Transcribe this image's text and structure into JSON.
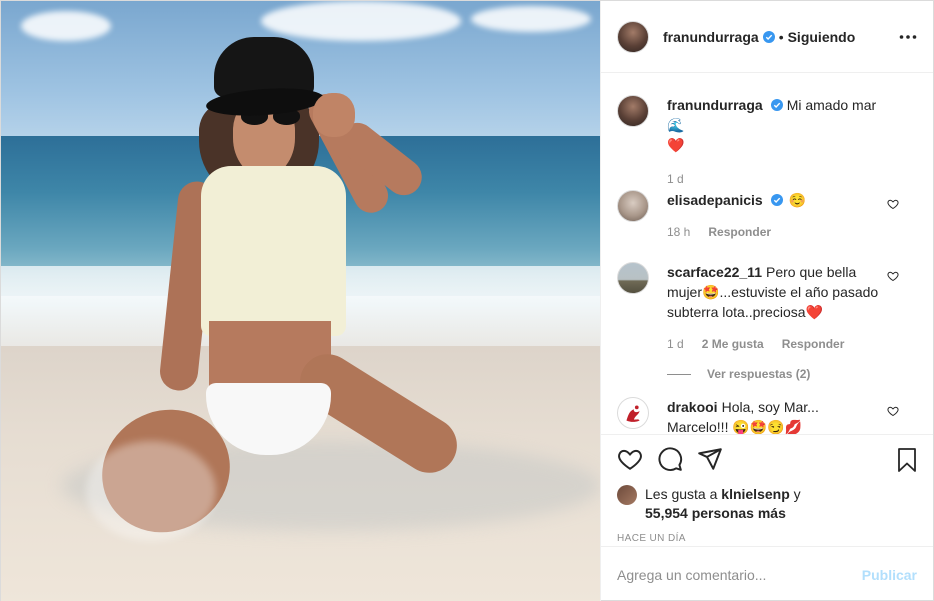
{
  "post": {
    "author": "franundurraga",
    "follow_status": "Siguiendo",
    "separator": "•",
    "caption_text": "Mi amado mar 🌊",
    "caption_emoji_line": "❤️",
    "caption_age": "1 d",
    "time_ago": "HACE UN DÍA",
    "brand_blue": "#0095f6",
    "publish_disabled_color": "#b2dffc"
  },
  "comments": [
    {
      "user": "elisadepanicis",
      "verified": true,
      "text": "☺️",
      "age": "18 h",
      "reply_label": "Responder"
    },
    {
      "user": "scarface22_11",
      "verified": false,
      "text": "Pero que bella mujer🤩...estuviste el año pasado subterra lota..preciosa❤️",
      "age": "1 d",
      "likes_label": "2 Me gusta",
      "reply_label": "Responder",
      "view_replies": "Ver respuestas (2)"
    },
    {
      "user": "drakooi",
      "verified": false,
      "text": "Hola, soy Mar... Marcelo!!! 😜🤩😏💋"
    }
  ],
  "likes": {
    "prefix": "Les gusta a",
    "user": "klnielsenp",
    "and": "y",
    "count_text": "55,954 personas más"
  },
  "composer": {
    "placeholder": "Agrega un comentario...",
    "publish_label": "Publicar"
  },
  "icons": {
    "more": "more-dots-icon",
    "like": "heart-icon",
    "comment": "comment-bubble-icon",
    "share": "paper-plane-icon",
    "save": "bookmark-icon",
    "verified": "verified-badge-icon"
  }
}
